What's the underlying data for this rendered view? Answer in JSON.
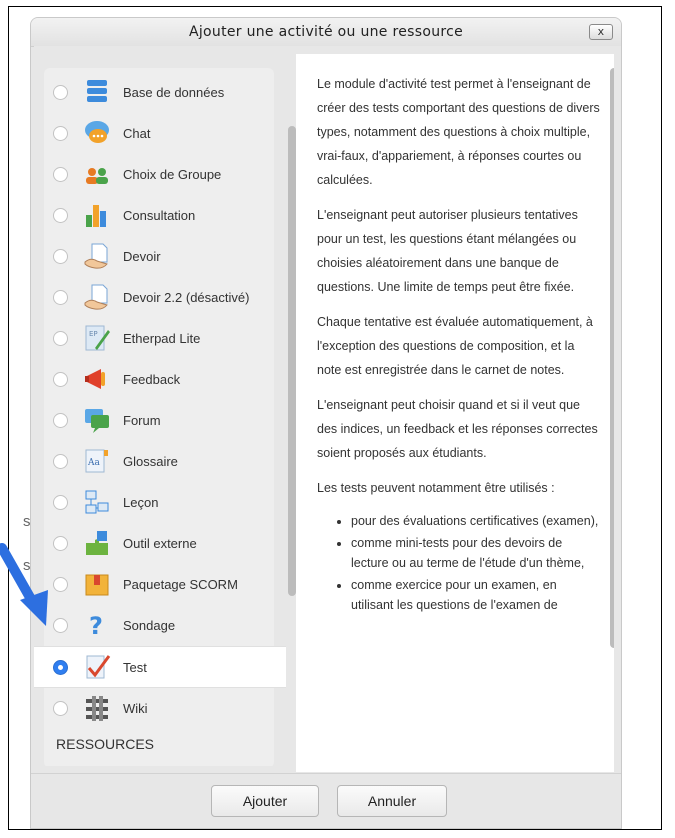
{
  "dialog": {
    "title": "Ajouter une activité ou une ressource",
    "close_label": "x"
  },
  "background": {
    "edge_letters": [
      "s",
      "s"
    ]
  },
  "options": [
    {
      "label": "Base de données",
      "icon": "database-icon",
      "selected": false
    },
    {
      "label": "Chat",
      "icon": "chat-icon",
      "selected": false
    },
    {
      "label": "Choix de Groupe",
      "icon": "group-choice-icon",
      "selected": false
    },
    {
      "label": "Consultation",
      "icon": "bar-chart-icon",
      "selected": false
    },
    {
      "label": "Devoir",
      "icon": "assignment-icon",
      "selected": false
    },
    {
      "label": "Devoir 2.2 (désactivé)",
      "icon": "assignment-icon",
      "selected": false
    },
    {
      "label": "Etherpad Lite",
      "icon": "etherpad-icon",
      "selected": false
    },
    {
      "label": "Feedback",
      "icon": "megaphone-icon",
      "selected": false
    },
    {
      "label": "Forum",
      "icon": "forum-icon",
      "selected": false
    },
    {
      "label": "Glossaire",
      "icon": "glossary-icon",
      "selected": false
    },
    {
      "label": "Leçon",
      "icon": "lesson-icon",
      "selected": false
    },
    {
      "label": "Outil externe",
      "icon": "puzzle-icon",
      "selected": false
    },
    {
      "label": "Paquetage SCORM",
      "icon": "package-icon",
      "selected": false
    },
    {
      "label": "Sondage",
      "icon": "question-icon",
      "selected": false
    },
    {
      "label": "Test",
      "icon": "quiz-check-icon",
      "selected": true
    },
    {
      "label": "Wiki",
      "icon": "wiki-icon",
      "selected": false
    }
  ],
  "section_resources": "RESSOURCES",
  "description": {
    "paragraphs": [
      "Le module d'activité test permet à l'enseignant de créer des tests comportant des questions de divers types, notamment des questions à choix multiple, vrai-faux, d'appariement, à réponses courtes ou calculées.",
      "L'enseignant peut autoriser plusieurs tentatives pour un test, les questions étant mélangées ou choisies aléatoirement dans une banque de questions. Une limite de temps peut être fixée.",
      "Chaque tentative est évaluée automatiquement, à l'exception des questions de composition, et la note est enregistrée dans le carnet de notes.",
      "L'enseignant peut choisir quand et si il veut que des indices, un feedback et les réponses correctes soient proposés aux étudiants.",
      "Les tests peuvent notamment être utilisés :"
    ],
    "bullets": [
      "pour des évaluations certificatives (examen),",
      "comme mini-tests pour des devoirs de lecture ou au terme de l'étude d'un thème,",
      "comme exercice pour un examen, en utilisant les questions de l'examen de"
    ]
  },
  "footer": {
    "add_label": "Ajouter",
    "cancel_label": "Annuler"
  },
  "colors": {
    "accent_radio": "#2f7ef0",
    "arrow": "#2d6fe0"
  }
}
